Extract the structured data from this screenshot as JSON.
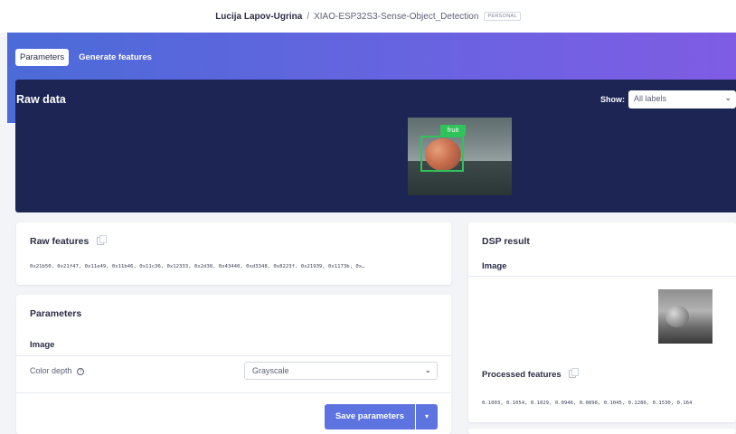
{
  "topbar": {
    "owner": "Lucija Lapov-Ugrina",
    "separator": "/",
    "project": "XIAO-ESP32S3-Sense-Object_Detection",
    "badge": "PERSONAL"
  },
  "tabs": [
    {
      "label": "Parameters",
      "active": true
    },
    {
      "label": "Generate features",
      "active": false
    }
  ],
  "raw_data": {
    "title": "Raw data",
    "show_label": "Show:",
    "show_value": "All labels",
    "bbox_label": "fruit"
  },
  "raw_features": {
    "title": "Raw features",
    "values": "0x21b50, 0x21f47, 0x11e49, 0x11b46, 0x11c36, 0x12333, 0x2d38, 0x43440, 0xd3348, 0x8223f, 0x21939, 0x1173b, 0x…"
  },
  "parameters": {
    "title": "Parameters",
    "section": "Image",
    "color_depth_label": "Color depth",
    "color_depth_value": "Grayscale",
    "save_label": "Save parameters"
  },
  "dsp_result": {
    "title": "DSP result",
    "image_label": "Image",
    "processed_title": "Processed features",
    "processed_values": "0.1003, 0.1054, 0.1029, 0.0946, 0.0898, 0.1045, 0.1286, 0.1530, 0.164"
  },
  "colors": {
    "accent": "#5d73e0",
    "panel": "#1d2555",
    "bbox": "#2fc35a"
  },
  "icons": [
    "copy-icon",
    "help-icon",
    "chevron-down-icon"
  ]
}
